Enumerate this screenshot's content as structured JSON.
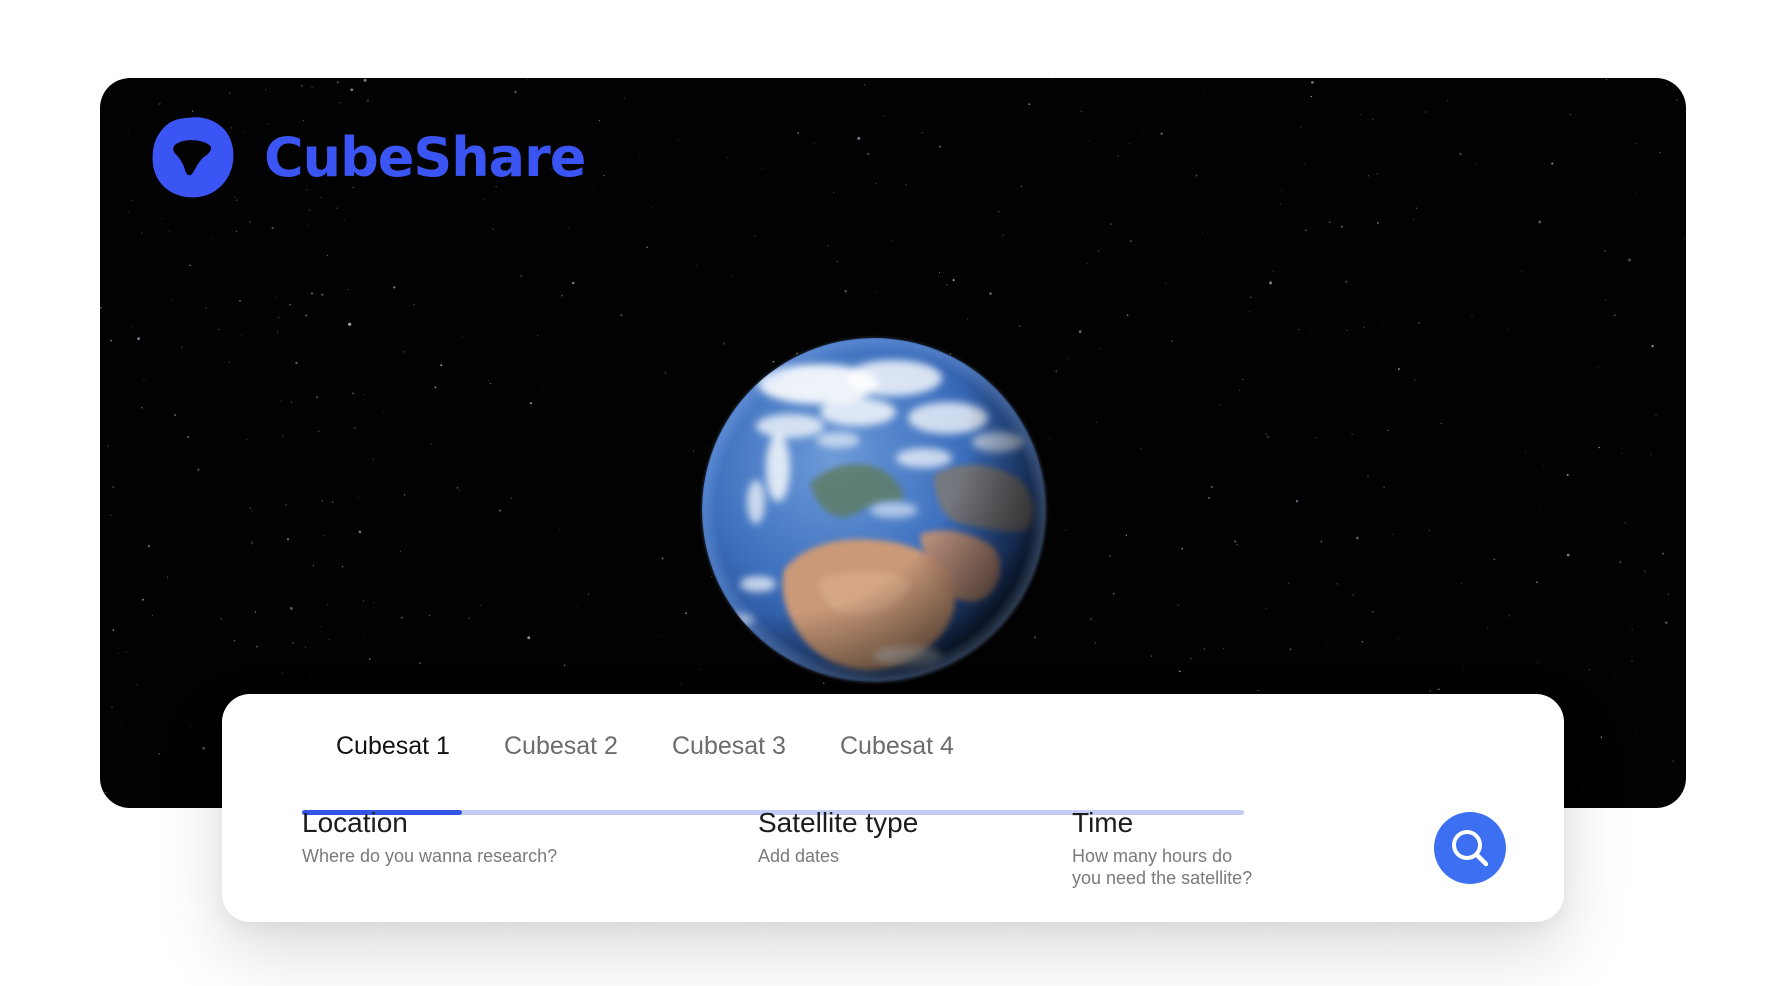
{
  "brand": {
    "name": "CubeShare",
    "color": "#3a55f3"
  },
  "hero": {
    "background_color": "#020203",
    "image": "earth-from-space"
  },
  "tabs": {
    "items": [
      {
        "label": "Cubesat 1",
        "active": true
      },
      {
        "label": "Cubesat 2",
        "active": false
      },
      {
        "label": "Cubesat 3",
        "active": false
      },
      {
        "label": "Cubesat 4",
        "active": false
      }
    ],
    "active_index": 0,
    "indicator_color": "#3355e6",
    "track_color": "#c3cdf6"
  },
  "search": {
    "location": {
      "label": "Location",
      "hint": "Where do you wanna research?"
    },
    "satellite_type": {
      "label": "Satellite type",
      "hint": "Add dates"
    },
    "time": {
      "label": "Time",
      "hint_line1": "How many hours do",
      "hint_line2": "you need the satellite?"
    },
    "button": {
      "icon": "search-icon",
      "color": "#3d6ff2"
    }
  }
}
